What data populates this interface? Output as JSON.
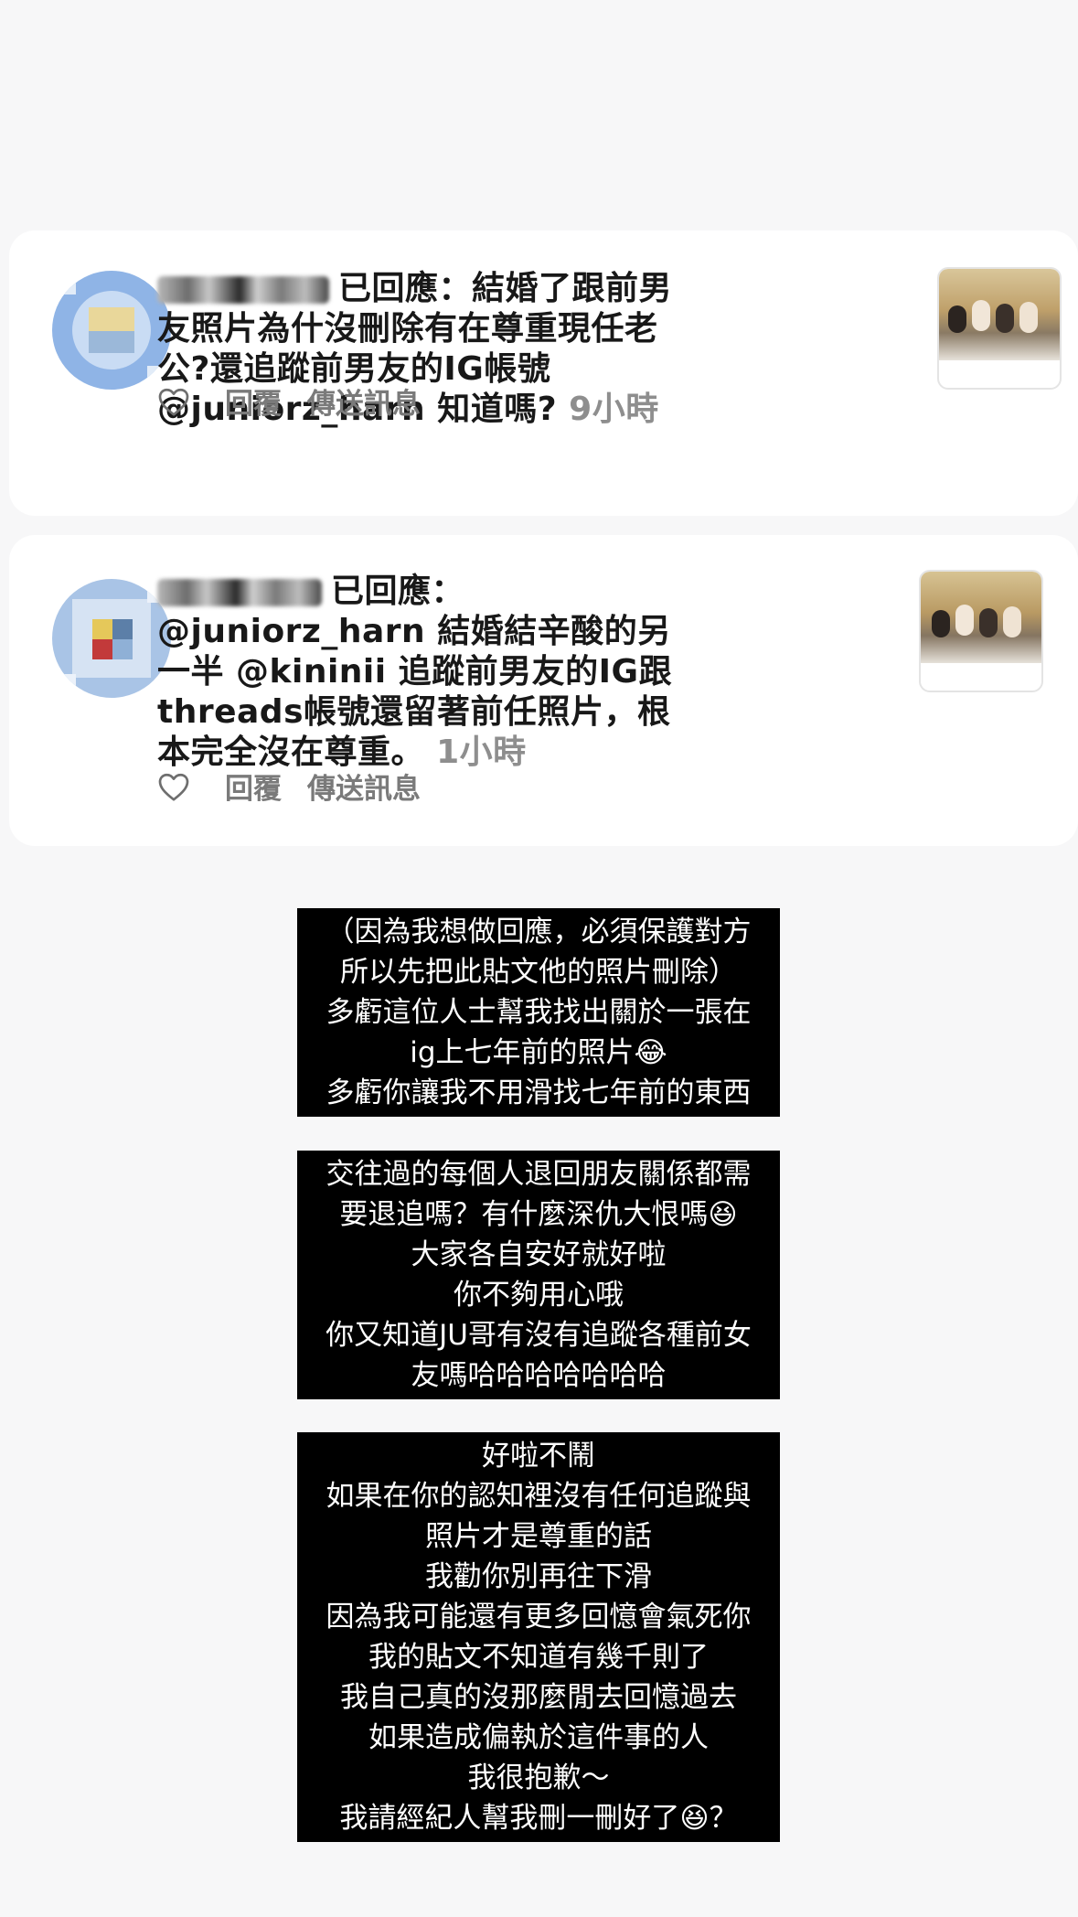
{
  "comments": [
    {
      "text": "已回應：結婚了跟前男友照片為什沒刪除有在尊重現任老公?還追蹤前男友的IG帳號 @juniorz_harn 知道嗎?",
      "time": "9小時",
      "reply_label": "回覆",
      "send_label": "傳送訊息"
    },
    {
      "text": "已回應：@juniorz_harn 結婚結辛酸的另一半 @kininii 追蹤前男友的IG跟threads帳號還留著前任照片，根本完全沒在尊重。",
      "time": "1小時",
      "reply_label": "回覆",
      "send_label": "傳送訊息"
    }
  ],
  "story_blocks": [
    {
      "lines": [
        "（因為我想做回應，必須保護對方",
        "所以先把此貼文他的照片刪除）",
        "多虧這位人士幫我找出關於一張在",
        "ig上七年前的照片😂",
        "多虧你讓我不用滑找七年前的東西"
      ]
    },
    {
      "lines": [
        "交往過的每個人退回朋友關係都需",
        "要退追嗎？有什麼深仇大恨嗎😆",
        "大家各自安好就好啦",
        "你不夠用心哦",
        "你又知道JU哥有沒有追蹤各種前女",
        "友嗎哈哈哈哈哈哈哈"
      ]
    },
    {
      "lines": [
        "好啦不鬧",
        "如果在你的認知裡沒有任何追蹤與",
        "照片才是尊重的話",
        "我勸你別再往下滑",
        "因為我可能還有更多回憶會氣死你",
        "我的貼文不知道有幾千則了",
        "我自己真的沒那麼閒去回憶過去",
        "如果造成偏執於這件事的人",
        "我很抱歉～",
        "我請經紀人幫我刪一刪好了😆？"
      ]
    }
  ]
}
